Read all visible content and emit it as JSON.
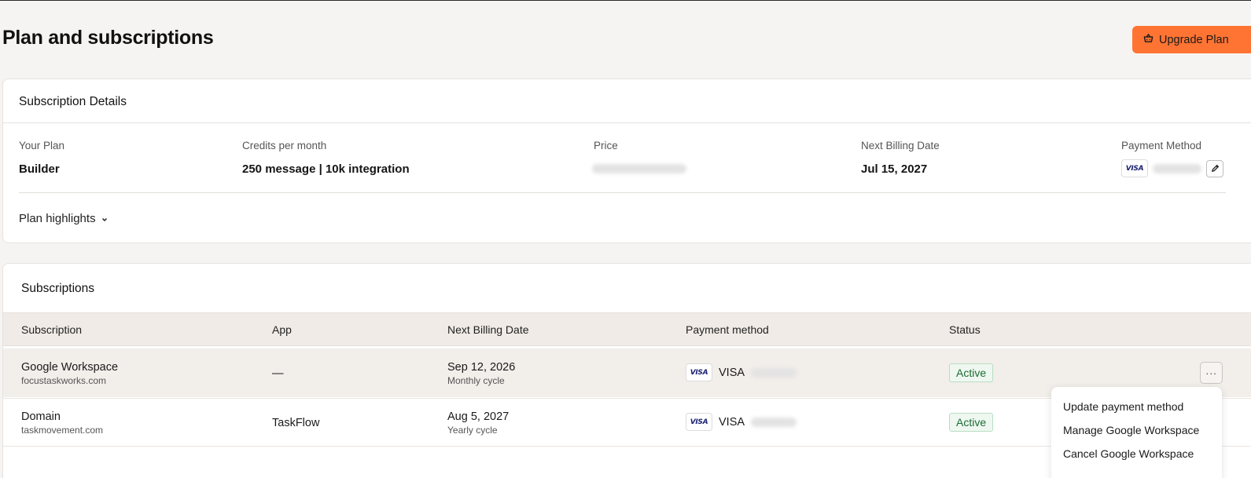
{
  "page": {
    "title": "Plan and subscriptions",
    "upgrade_label": "Upgrade Plan"
  },
  "details": {
    "title": "Subscription Details",
    "plan_label": "Your Plan",
    "plan_value": "Builder",
    "credits_label": "Credits per month",
    "credits_value": "250 message | 10k integration",
    "price_label": "Price",
    "next_billing_label": "Next Billing Date",
    "next_billing_value": "Jul 15, 2027",
    "payment_label": "Payment Method",
    "payment_card_brand": "VISA",
    "highlights_label": "Plan highlights"
  },
  "subscriptions": {
    "title": "Subscriptions",
    "columns": [
      "Subscription",
      "App",
      "Next Billing Date",
      "Payment method",
      "Status"
    ],
    "rows": [
      {
        "name": "Google Workspace",
        "domain": "focustaskworks.com",
        "app": "—",
        "next_billing": "Sep 12, 2026",
        "cycle": "Monthly cycle",
        "card_brand": "VISA",
        "payment": "VISA",
        "status": "Active"
      },
      {
        "name": "Domain",
        "domain": "taskmovement.com",
        "app": "TaskFlow",
        "next_billing": "Aug 5, 2027",
        "cycle": "Yearly cycle",
        "card_brand": "VISA",
        "payment": "VISA",
        "status": "Active"
      }
    ],
    "more_label": "···"
  },
  "menu": {
    "items": [
      "Update payment method",
      "Manage Google Workspace",
      "Cancel Google Workspace"
    ]
  },
  "colors": {
    "accent": "#ff7433",
    "status_active_bg": "#eef8f0",
    "status_active_text": "#1e6b34",
    "visa_blue": "#1a1f71"
  },
  "icons": {
    "upgrade": "basket-icon",
    "edit": "pencil-icon",
    "expand": "chevron-down-icon"
  }
}
